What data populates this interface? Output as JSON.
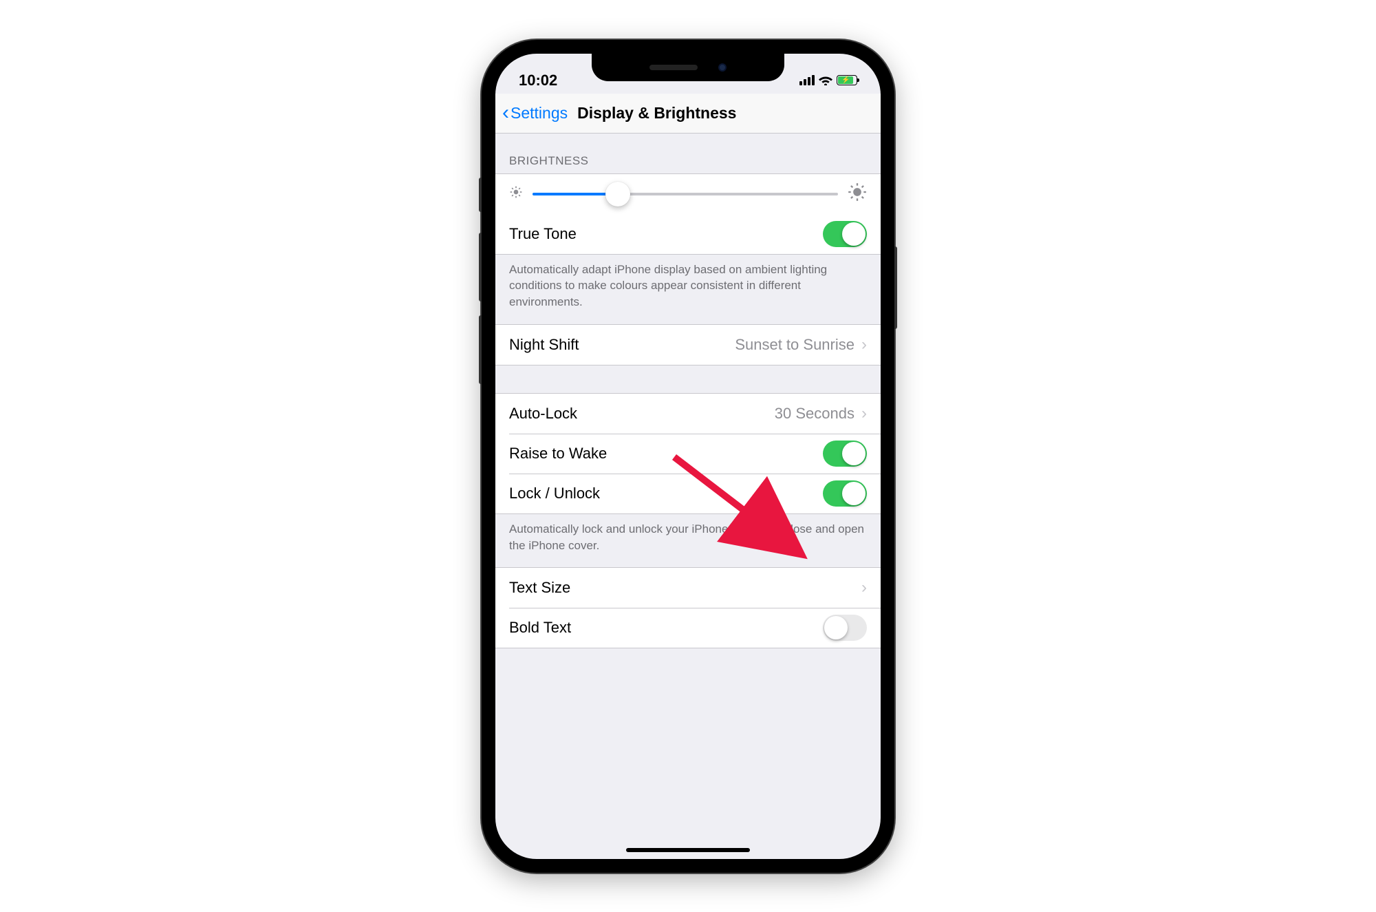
{
  "status": {
    "time": "10:02"
  },
  "nav": {
    "back": "Settings",
    "title": "Display & Brightness"
  },
  "sections": {
    "brightness": {
      "header": "BRIGHTNESS",
      "truetone_label": "True Tone",
      "truetone_on": true,
      "footer": "Automatically adapt iPhone display based on ambient lighting conditions to make colours appear consistent in different environments."
    },
    "nightshift": {
      "label": "Night Shift",
      "value": "Sunset to Sunrise"
    },
    "lock": {
      "autolock_label": "Auto-Lock",
      "autolock_value": "30 Seconds",
      "raise_label": "Raise to Wake",
      "raise_on": true,
      "lockunlock_label": "Lock / Unlock",
      "lockunlock_on": true,
      "footer": "Automatically lock and unlock your iPhone when you close and open the iPhone cover."
    },
    "text": {
      "textsize_label": "Text Size",
      "bold_label": "Bold Text",
      "bold_on": false
    }
  }
}
